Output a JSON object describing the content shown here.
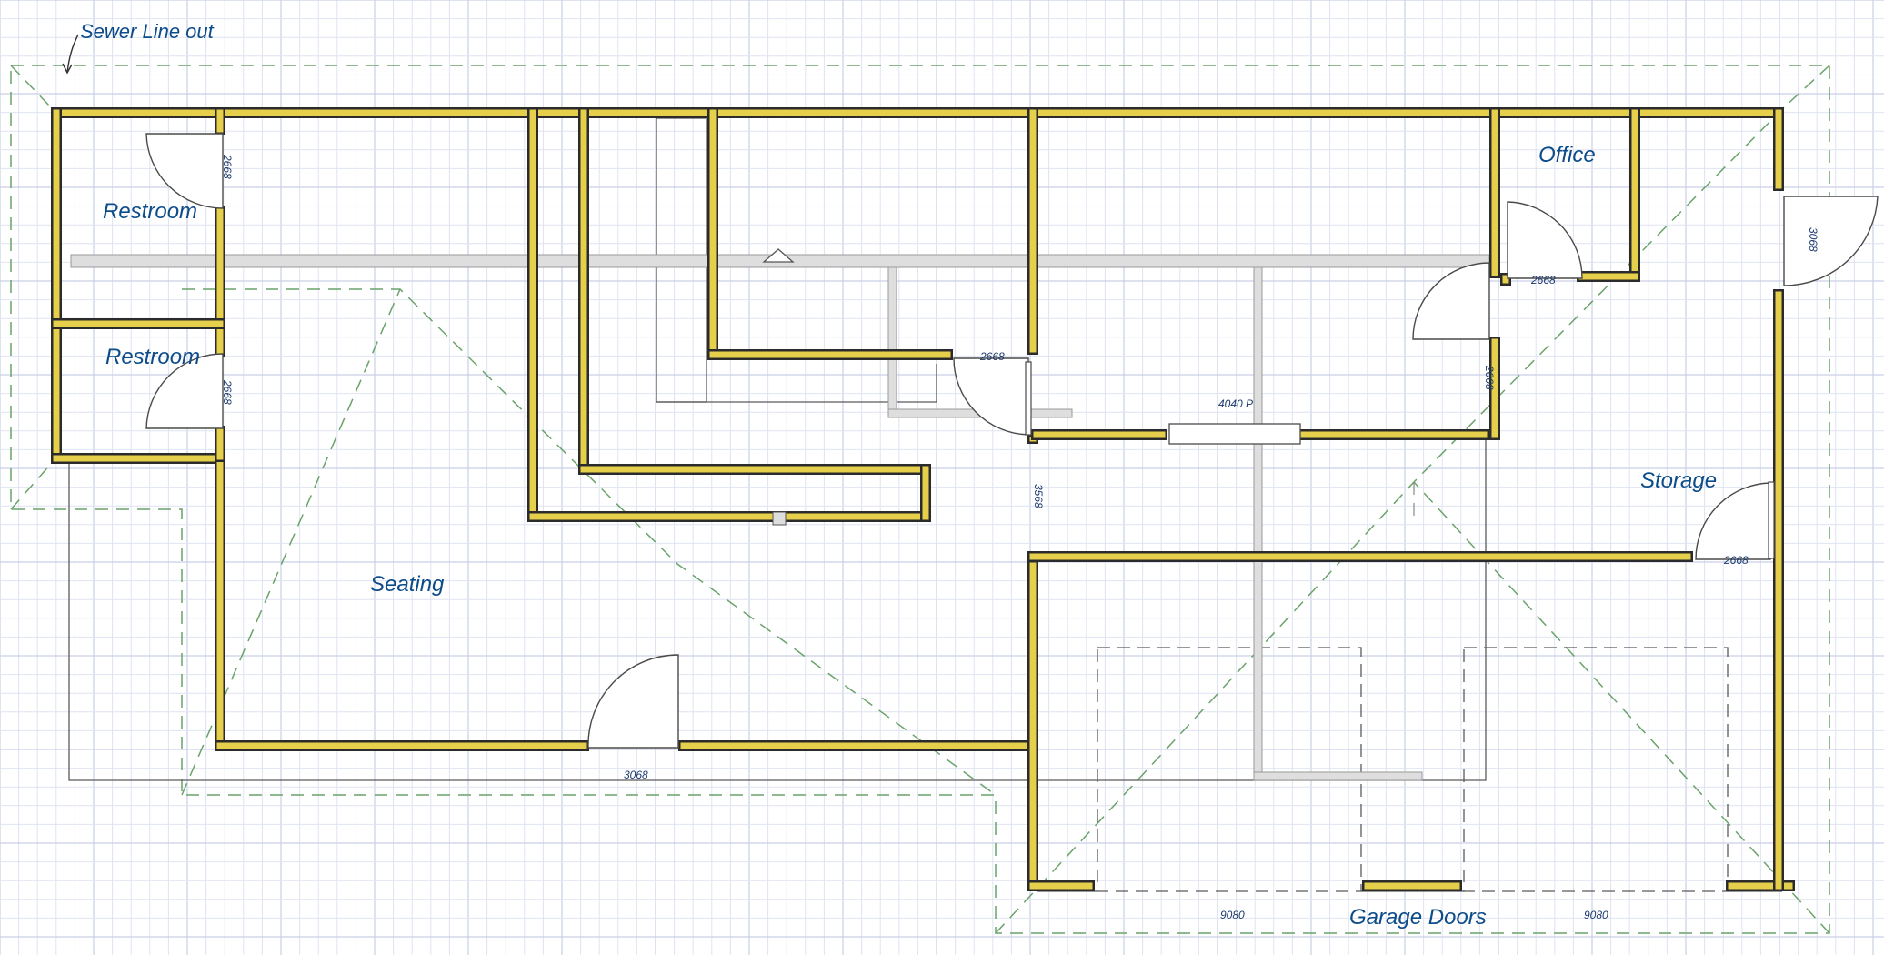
{
  "labels": {
    "sewer": "Sewer Line out",
    "restroom_1": "Restroom",
    "restroom_2": "Restroom",
    "seating": "Seating",
    "office": "Office",
    "storage": "Storage",
    "garage_doors": "Garage Doors"
  },
  "dimensions": {
    "restroom_1_door": "2668",
    "restroom_2_door": "2668",
    "office_door": "2668",
    "side_exit_door": "3068",
    "kitchen_door": "2668",
    "passage": "4040 P",
    "right_hall_door": "2668",
    "hall_opening": "3568",
    "storage_door": "2668",
    "front_door": "3068",
    "garage_door_left": "9080",
    "garage_door_right": "9080"
  },
  "colors": {
    "wall": "#e6cf4a",
    "label": "#0d4c8a",
    "roof_line": "#6aa36a",
    "grid": "#dfe4f2"
  }
}
